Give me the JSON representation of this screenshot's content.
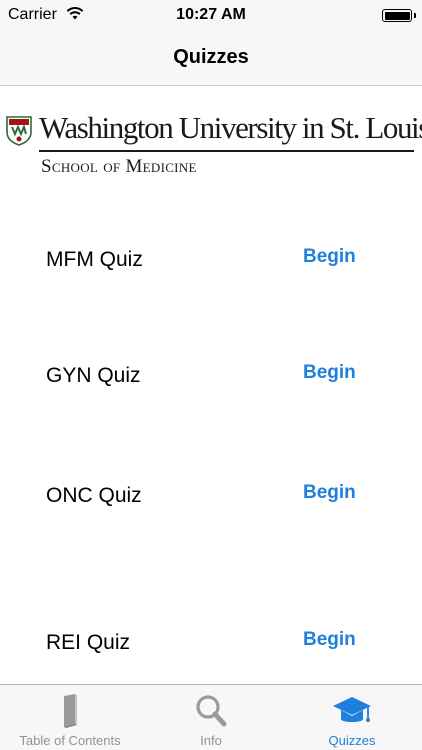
{
  "status_bar": {
    "carrier": "Carrier",
    "time": "10:27 AM",
    "battery_level": 1.0
  },
  "nav": {
    "title": "Quizzes"
  },
  "logo": {
    "name": "Washington University in St. Louis",
    "school": "School of Medicine",
    "colors": {
      "seal_red": "#a51417",
      "seal_green": "#2f6b3a",
      "text": "#1a1a1a"
    }
  },
  "quizzes": [
    {
      "label": "MFM Quiz",
      "action": "Begin"
    },
    {
      "label": "GYN Quiz",
      "action": "Begin"
    },
    {
      "label": "ONC Quiz",
      "action": "Begin"
    },
    {
      "label": "REI Quiz",
      "action": "Begin"
    }
  ],
  "tab_bar": {
    "tabs": [
      {
        "label": "Table of Contents",
        "icon": "book-icon",
        "active": false
      },
      {
        "label": "Info",
        "icon": "magnifier-icon",
        "active": false
      },
      {
        "label": "Quizzes",
        "icon": "graduation-cap-icon",
        "active": true
      }
    ]
  },
  "colors": {
    "accent": "#1e7fdc",
    "inactive_tab": "#929292",
    "bar_background": "#f7f7f7"
  }
}
